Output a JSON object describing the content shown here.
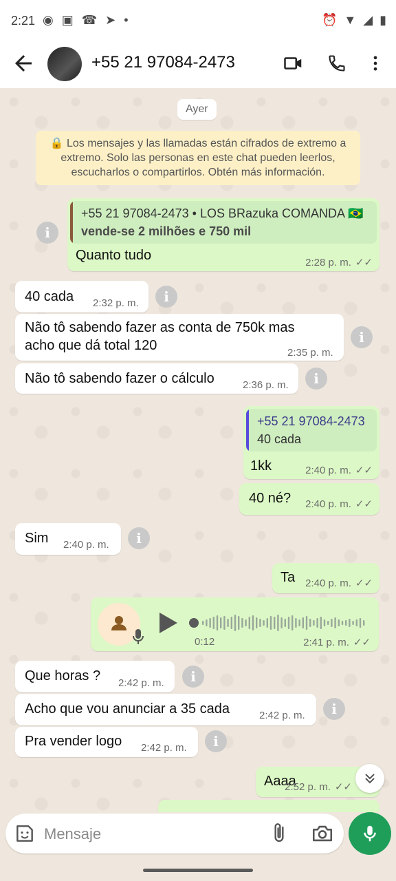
{
  "status_bar": {
    "time": "2:21"
  },
  "header": {
    "title": "+55 21 97084-2473"
  },
  "chat": {
    "date_chip": "Ayer",
    "encryption_notice": "🔒 Los mensajes y las llamadas están cifrados de extremo a extremo. Solo las personas en este chat pueden leerlos, escucharlos o compartirlos. Obtén más información.",
    "messages": [
      {
        "id": "m1",
        "dir": "out",
        "quote_name": "+55 21 97084-2473 • LOS BRazuka COMANDA 🇧🇷",
        "quote_text": "vende-se 2 milhões e 750 mil",
        "text": "Quanto tudo",
        "time": "2:28 p. m."
      },
      {
        "id": "m2",
        "dir": "in",
        "text": "40 cada",
        "time": "2:32 p. m."
      },
      {
        "id": "m3",
        "dir": "in",
        "text_line1": "Não tô sabendo fazer as conta de 750k mas",
        "text_line2": "acho que dá total 120",
        "time": "2:35 p. m."
      },
      {
        "id": "m4",
        "dir": "in",
        "text": "Não tô sabendo fazer o cálculo",
        "time": "2:36 p. m."
      },
      {
        "id": "m5",
        "dir": "out",
        "quote_name": "+55 21 97084-2473",
        "quote_text": "40 cada",
        "text": "1kk",
        "time": "2:40 p. m."
      },
      {
        "id": "m6",
        "dir": "out",
        "text": "40 né?",
        "time": "2:40 p. m."
      },
      {
        "id": "m7",
        "dir": "in",
        "text": "Sim",
        "time": "2:40 p. m."
      },
      {
        "id": "m8",
        "dir": "out",
        "text": "Ta",
        "time": "2:40 p. m."
      },
      {
        "id": "m9",
        "dir": "out",
        "type": "audio",
        "duration": "0:12",
        "time": "2:41 p. m."
      },
      {
        "id": "m10",
        "dir": "in",
        "text": "Que horas ?",
        "time": "2:42 p. m."
      },
      {
        "id": "m11",
        "dir": "in",
        "text": "Acho que vou anunciar a 35 cada",
        "time": "2:42 p. m."
      },
      {
        "id": "m12",
        "dir": "in",
        "text": "Pra vender logo",
        "time": "2:42 p. m."
      },
      {
        "id": "m13",
        "dir": "out",
        "text": "Aaaa",
        "time": "2:52 p. m."
      }
    ]
  },
  "composer": {
    "placeholder": "Mensaje"
  },
  "colors": {
    "outgoing_bubble": "#dcf8c6",
    "incoming_bubble": "#ffffff",
    "accent_green": "#1f9e5a",
    "chat_background": "#efe7dd"
  }
}
